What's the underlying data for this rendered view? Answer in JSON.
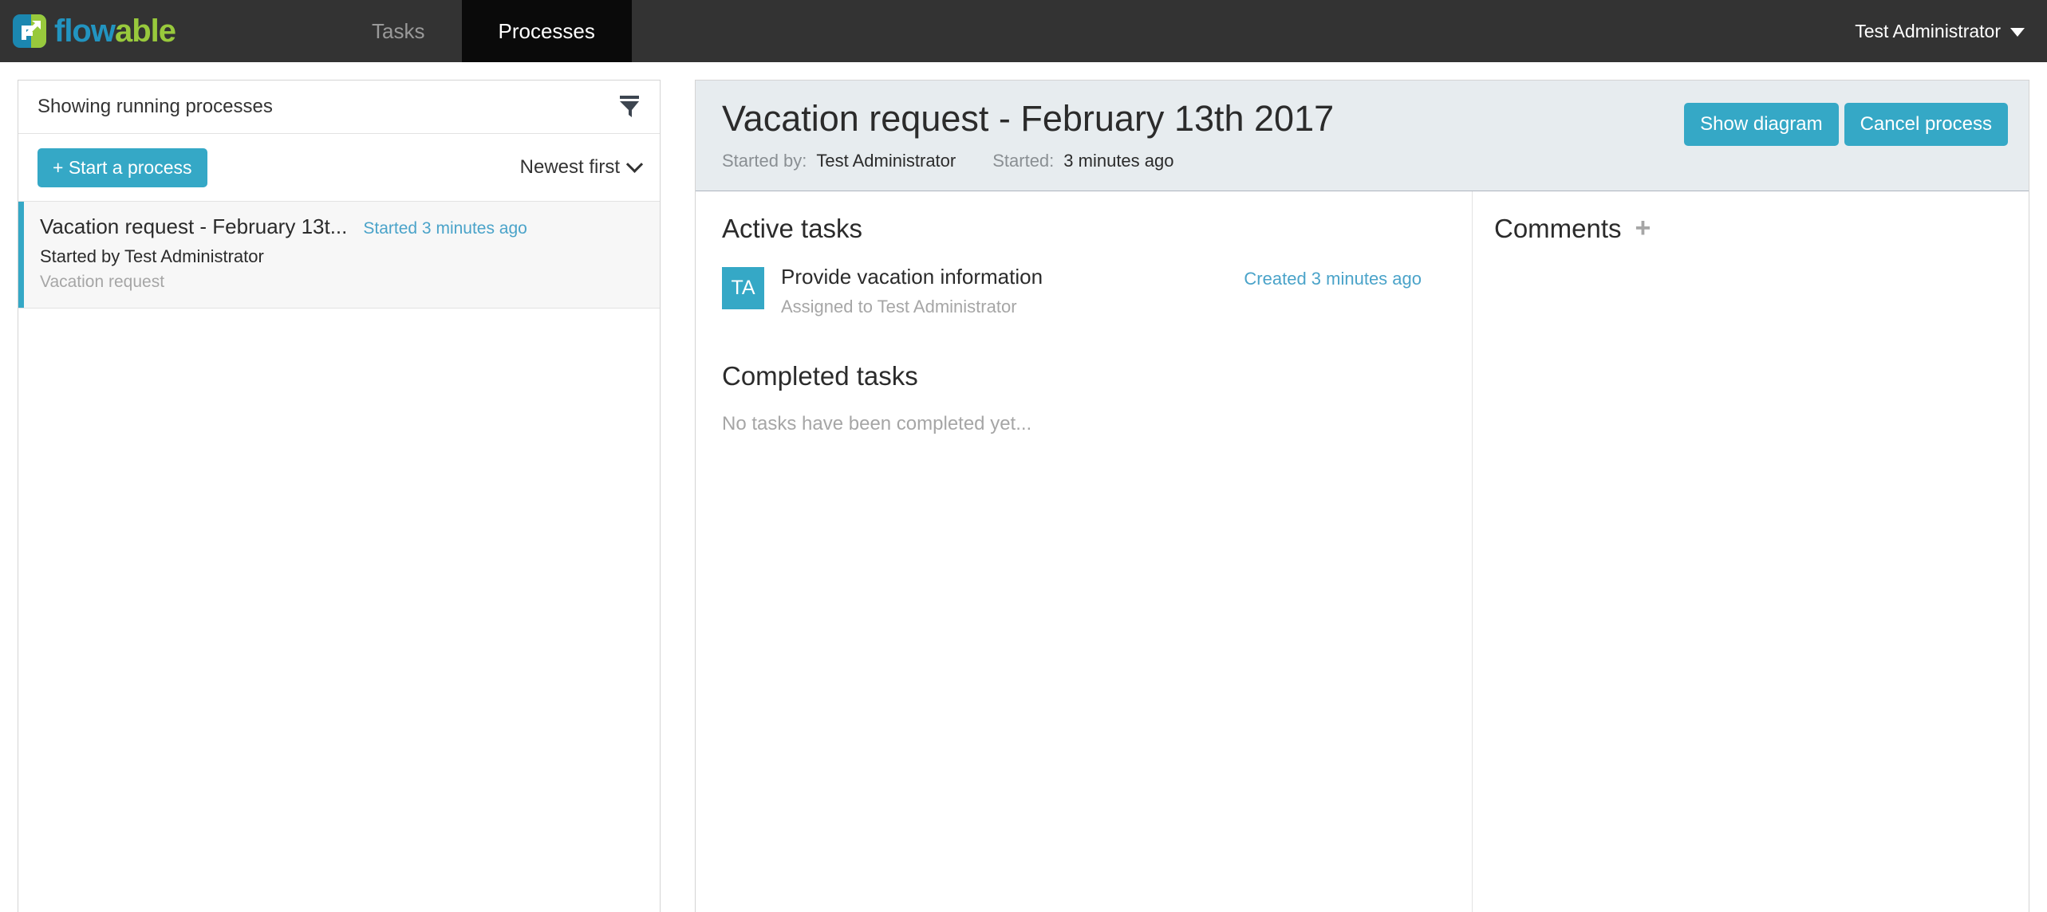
{
  "topbar": {
    "brand": {
      "word_part1": "flow",
      "word_part2": "able",
      "logo_icon": "flowable-arrow-logo"
    },
    "tabs": [
      {
        "label": "Tasks",
        "active": false
      },
      {
        "label": "Processes",
        "active": true
      }
    ],
    "user": {
      "name": "Test Administrator",
      "caret_icon": "chevron-down-icon"
    },
    "colors": {
      "bar_bg": "#333333",
      "active_tab_bg": "#0a0a0a",
      "brand_blue": "#2294c0",
      "brand_green": "#98c93c"
    }
  },
  "sidebar": {
    "header_title": "Showing running processes",
    "filter_icon": "filter-funnel-icon",
    "start_button_label": "+ Start a process",
    "sort_label": "Newest first",
    "sort_caret_icon": "chevron-down-icon",
    "processes": [
      {
        "title": "Vacation request - February 13t...",
        "started": "Started 3 minutes ago",
        "started_by": "Started by Test Administrator",
        "definition": "Vacation request",
        "selected": true
      }
    ]
  },
  "main": {
    "title": "Vacation request - February 13th 2017",
    "meta": {
      "started_by_label": "Started by:",
      "started_by_value": "Test Administrator",
      "started_label": "Started:",
      "started_value": "3 minutes ago"
    },
    "buttons": {
      "show_diagram": "Show diagram",
      "cancel_process": "Cancel process"
    },
    "active_tasks": {
      "heading": "Active tasks",
      "items": [
        {
          "initials": "TA",
          "name": "Provide vacation information",
          "assignee": "Assigned to Test Administrator",
          "created": "Created 3 minutes ago"
        }
      ]
    },
    "completed_tasks": {
      "heading": "Completed tasks",
      "empty_message": "No tasks have been completed yet..."
    },
    "comments": {
      "heading": "Comments",
      "add_icon": "plus-icon"
    },
    "colors": {
      "accent": "#35a8c6",
      "header_bg": "#e7ecef",
      "link": "#4aa3c9"
    }
  }
}
